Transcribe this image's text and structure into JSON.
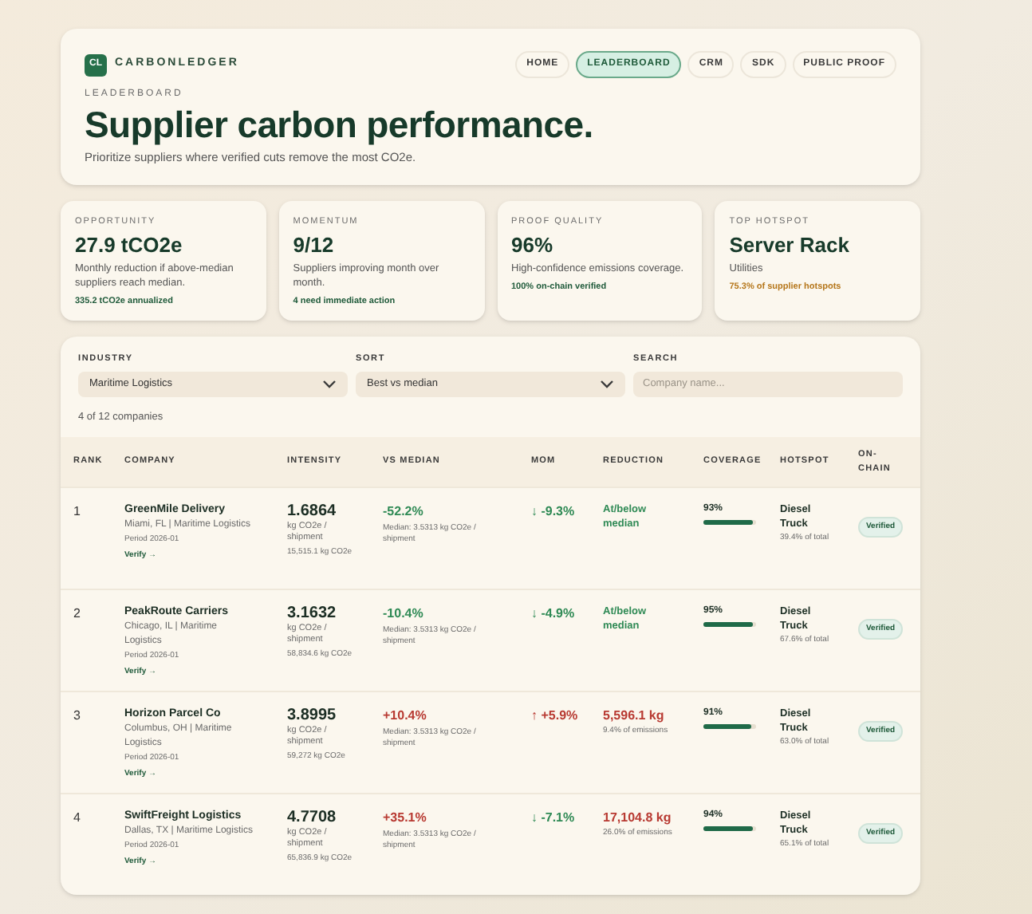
{
  "brand": {
    "logo": "CL",
    "name": "CARBONLEDGER"
  },
  "nav": [
    {
      "label": "HOME",
      "selected": false
    },
    {
      "label": "LEADERBOARD",
      "selected": true
    },
    {
      "label": "CRM",
      "selected": false
    },
    {
      "label": "SDK",
      "selected": false
    },
    {
      "label": "PUBLIC PROOF",
      "selected": false
    }
  ],
  "header": {
    "eyebrow": "LEADERBOARD",
    "title": "Supplier carbon performance.",
    "subtitle": "Prioritize suppliers where verified cuts remove the most CO2e."
  },
  "stats": [
    {
      "label": "OPPORTUNITY",
      "value": "27.9 tCO2e",
      "description": "Monthly reduction if above-median suppliers reach median.",
      "note": "335.2 tCO2e annualized",
      "kind": "good"
    },
    {
      "label": "MOMENTUM",
      "value": "9/12",
      "description": "Suppliers improving month over month.",
      "note": "4 need immediate action",
      "kind": "good"
    },
    {
      "label": "PROOF QUALITY",
      "value": "96%",
      "description": "High-confidence emissions coverage.",
      "note": "100% on-chain verified",
      "kind": "good"
    },
    {
      "label": "TOP HOTSPOT",
      "value": "Server Rack",
      "description": "Utilities",
      "note": "75.3% of supplier hotspots",
      "kind": "warn"
    }
  ],
  "filters": {
    "industry": {
      "label": "INDUSTRY",
      "value": "Maritime Logistics"
    },
    "sort": {
      "label": "SORT",
      "value": "Best vs median"
    },
    "search": {
      "label": "SEARCH",
      "placeholder": "Company name..."
    },
    "count": "4 of 12 companies"
  },
  "table": {
    "columns": [
      "RANK",
      "COMPANY",
      "INTENSITY",
      "VS MEDIAN",
      "MOM",
      "REDUCTION",
      "COVERAGE",
      "HOTSPOT",
      "ON-CHAIN"
    ],
    "rows": [
      {
        "rank": "1",
        "company": "GreenMile Delivery",
        "location": "Miami, FL | Maritime Logistics",
        "period": "Period 2026-01",
        "link": "Verify →",
        "intensity": "1.6864",
        "unit": "kg CO2e / shipment",
        "total": "15,515.1 kg CO2e",
        "vs_median": "-52.2%",
        "vs_good": true,
        "median": "Median: 3.5313 kg CO2e / shipment",
        "mom": "↓ -9.3%",
        "mom_good": true,
        "reduction": {
          "kind": "median",
          "value": "At/below median"
        },
        "coverage": "93%",
        "level": 0.93,
        "hotspot": "Diesel Truck",
        "hotspot_share": "39.4% of total",
        "badge": "Verified"
      },
      {
        "rank": "2",
        "company": "PeakRoute Carriers",
        "location": "Chicago, IL | Maritime Logistics",
        "period": "Period 2026-01",
        "link": "Verify →",
        "intensity": "3.1632",
        "unit": "kg CO2e / shipment",
        "total": "58,834.6 kg CO2e",
        "vs_median": "-10.4%",
        "vs_good": true,
        "median": "Median: 3.5313 kg CO2e / shipment",
        "mom": "↓ -4.9%",
        "mom_good": true,
        "reduction": {
          "kind": "median",
          "value": "At/below median"
        },
        "coverage": "95%",
        "level": 0.95,
        "hotspot": "Diesel Truck",
        "hotspot_share": "67.6% of total",
        "badge": "Verified"
      },
      {
        "rank": "3",
        "company": "Horizon Parcel Co",
        "location": "Columbus, OH | Maritime Logistics",
        "period": "Period 2026-01",
        "link": "Verify →",
        "intensity": "3.8995",
        "unit": "kg CO2e / shipment",
        "total": "59,272 kg CO2e",
        "vs_median": "+10.4%",
        "vs_good": false,
        "median": "Median: 3.5313 kg CO2e / shipment",
        "mom": "↑ +5.9%",
        "mom_good": false,
        "reduction": {
          "kind": "amount",
          "value": "5,596.1 kg",
          "note": "9.4% of emissions"
        },
        "coverage": "91%",
        "level": 0.91,
        "hotspot": "Diesel Truck",
        "hotspot_share": "63.0% of total",
        "badge": "Verified"
      },
      {
        "rank": "4",
        "company": "SwiftFreight Logistics",
        "location": "Dallas, TX | Maritime Logistics",
        "period": "Period 2026-01",
        "link": "Verify →",
        "intensity": "4.7708",
        "unit": "kg CO2e / shipment",
        "total": "65,836.9 kg CO2e",
        "vs_median": "+35.1%",
        "vs_good": false,
        "median": "Median: 3.5313 kg CO2e / shipment",
        "mom": "↓ -7.1%",
        "mom_good": true,
        "reduction": {
          "kind": "amount",
          "value": "17,104.8 kg",
          "note": "26.0% of emissions"
        },
        "coverage": "94%",
        "level": 0.94,
        "hotspot": "Diesel Truck",
        "hotspot_share": "65.1% of total",
        "badge": "Verified"
      }
    ]
  }
}
